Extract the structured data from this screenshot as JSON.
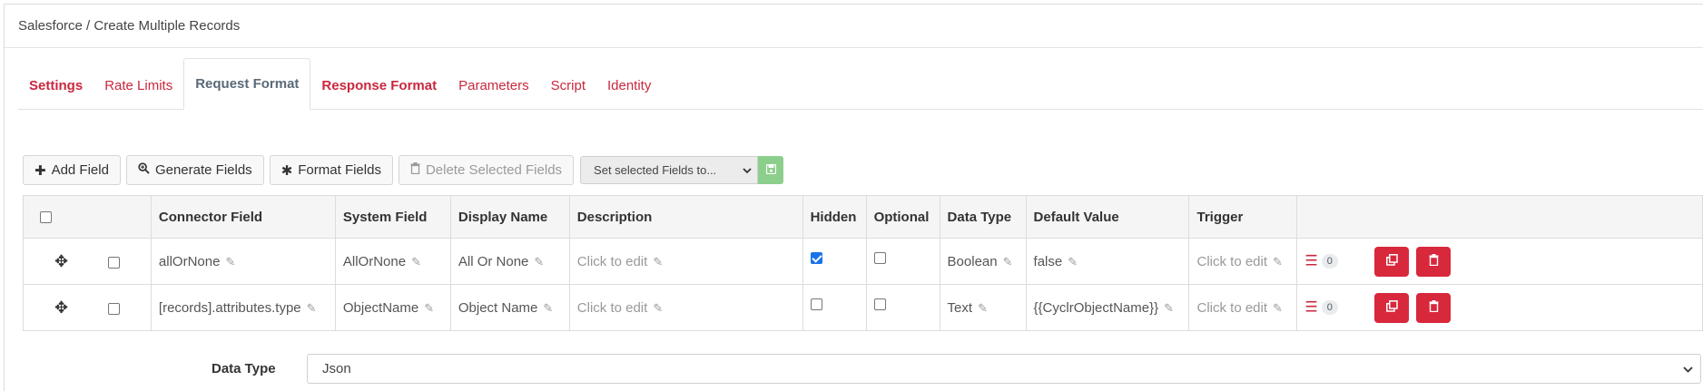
{
  "header": {
    "title": "Salesforce / Create Multiple Records"
  },
  "tabs": [
    {
      "label": "Settings"
    },
    {
      "label": "Rate Limits"
    },
    {
      "label": "Request Format"
    },
    {
      "label": "Response Format"
    },
    {
      "label": "Parameters"
    },
    {
      "label": "Script"
    },
    {
      "label": "Identity"
    }
  ],
  "toolbar": {
    "add_field": "Add Field",
    "generate_fields": "Generate Fields",
    "format_fields": "Format Fields",
    "delete_selected": "Delete Selected Fields",
    "set_selected": "Set selected Fields to..."
  },
  "table": {
    "headers": {
      "connector_field": "Connector Field",
      "system_field": "System Field",
      "display_name": "Display Name",
      "description": "Description",
      "hidden": "Hidden",
      "optional": "Optional",
      "data_type": "Data Type",
      "default_value": "Default Value",
      "trigger": "Trigger"
    },
    "rows": [
      {
        "connector_field": "allOrNone",
        "system_field": "AllOrNone",
        "display_name": "All Or None",
        "description": "Click to edit",
        "hidden": true,
        "optional": false,
        "data_type": "Boolean",
        "default_value": "false",
        "trigger": "Click to edit",
        "count": "0"
      },
      {
        "connector_field": "[records].attributes.type",
        "system_field": "ObjectName",
        "display_name": "Object Name",
        "description": "Click to edit",
        "hidden": false,
        "optional": false,
        "data_type": "Text",
        "default_value": "{{CyclrObjectName}}",
        "trigger": "Click to edit",
        "count": "0"
      }
    ]
  },
  "data_type_row": {
    "label": "Data Type",
    "value": "Json"
  },
  "colors": {
    "accent": "#c9283e",
    "danger_button": "#d8283c",
    "save_button": "#8ccf8c",
    "checkbox": "#1a73e8"
  }
}
